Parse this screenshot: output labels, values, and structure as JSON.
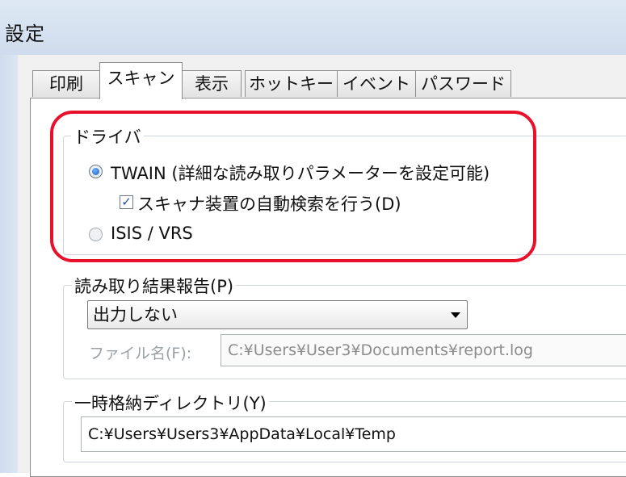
{
  "window": {
    "title": "設定"
  },
  "tabs": [
    {
      "label": "印刷"
    },
    {
      "label": "スキャン"
    },
    {
      "label": "表示"
    },
    {
      "label": "ホットキー"
    },
    {
      "label": "イベント"
    },
    {
      "label": "パスワード"
    }
  ],
  "driver": {
    "label": "ドライバ",
    "twain_label": "TWAIN (詳細な読み取りパラメーターを設定可能)",
    "auto_detect_label": "スキャナ装置の自動検索を行う(D)",
    "auto_detect_checked": true,
    "isis_label": "ISIS / VRS",
    "selected": "TWAIN"
  },
  "report": {
    "label": "読み取り結果報告(P)",
    "selected": "出力しない",
    "filename_label": "ファイル名(F):",
    "filename_value": "C:¥Users¥User3¥Documents¥report.log"
  },
  "temp_dir": {
    "label": "一時格納ディレクトリ(Y)",
    "value": "C:¥Users¥Users3¥AppData¥Local¥Temp"
  },
  "colors": {
    "highlight": "#e8102b",
    "radio_selected": "#1c5fb8"
  }
}
